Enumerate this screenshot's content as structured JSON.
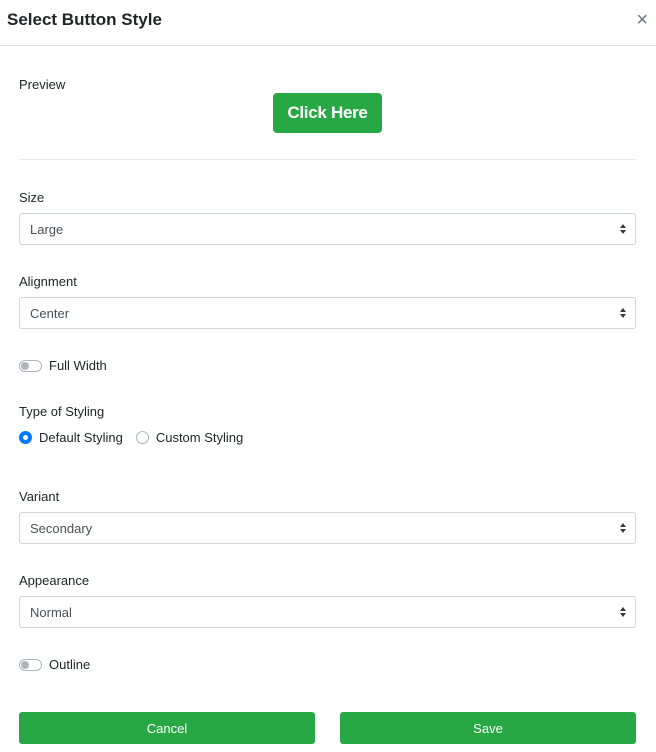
{
  "modal": {
    "title": "Select Button Style",
    "close_label": "×"
  },
  "preview": {
    "label": "Preview",
    "button_text": "Click Here",
    "button_color": "#28a745"
  },
  "size": {
    "label": "Size",
    "value": "Large"
  },
  "alignment": {
    "label": "Alignment",
    "value": "Center"
  },
  "full_width": {
    "label": "Full Width",
    "on": false
  },
  "styling_type": {
    "label": "Type of Styling",
    "options": [
      "Default Styling",
      "Custom Styling"
    ],
    "selected": "Default Styling"
  },
  "variant": {
    "label": "Variant",
    "value": "Secondary"
  },
  "appearance": {
    "label": "Appearance",
    "value": "Normal"
  },
  "outline": {
    "label": "Outline",
    "on": false
  },
  "footer": {
    "cancel_label": "Cancel",
    "save_label": "Save"
  },
  "colors": {
    "accent_green": "#28a745",
    "radio_blue": "#007bff"
  }
}
